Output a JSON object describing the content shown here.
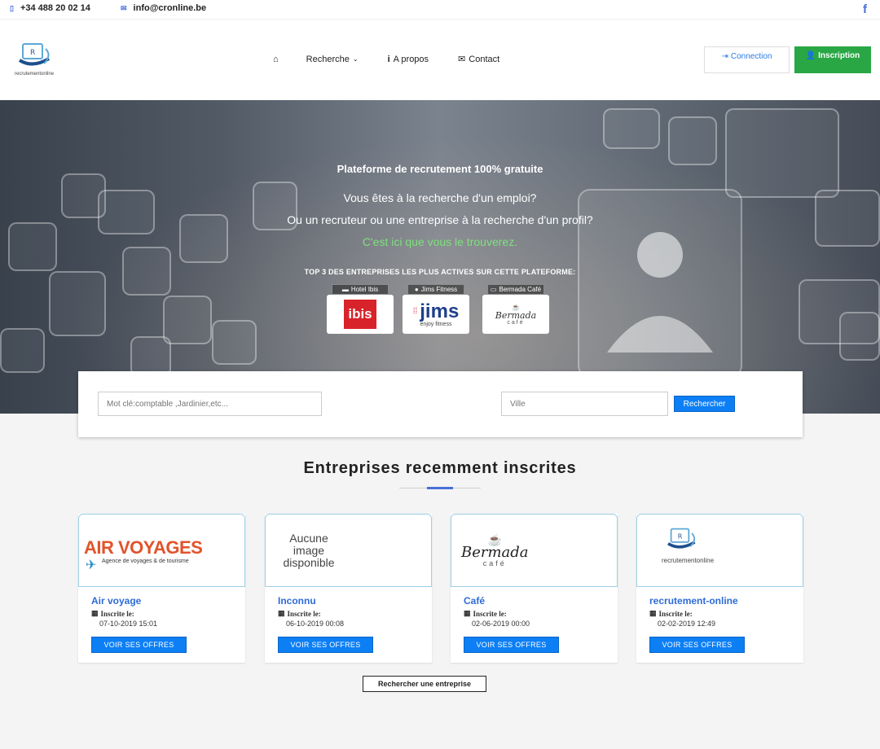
{
  "topbar": {
    "phone": "+34 488 20 02 14",
    "email": "info@cronline.be",
    "facebook_label": "f"
  },
  "header": {
    "logo_text": "recrutementonline",
    "nav": {
      "home_icon": "home-icon",
      "search_label": "Recherche",
      "about_label": "A propos",
      "contact_label": "Contact"
    },
    "connect_label": "Connection",
    "register_label": "Inscription"
  },
  "hero": {
    "title": "Plateforme de recrutement 100% gratuite",
    "line1": "Vous êtes à la recherche d'un emploi?",
    "line2": "Ou un recruteur ou une entreprise à la recherche d'un profil?",
    "line3": "C'est ici que vous le trouverez.",
    "top3_heading": "TOP 3 DES ENTREPRISES LES PLUS ACTIVES SUR CETTE PLATEFORME:",
    "top3": [
      {
        "tag": "Hotel Ibis",
        "logo_text": "ibis"
      },
      {
        "tag": "Jims Fitness",
        "logo_text": "jims",
        "logo_sub": "enjoy fitness"
      },
      {
        "tag": "Bermada Café",
        "logo_text": "Bermada",
        "logo_sub": "café"
      }
    ]
  },
  "search": {
    "keyword_placeholder": "Mot clé:comptable ,Jardinier,etc...",
    "city_placeholder": "Ville",
    "button_label": "Rechercher"
  },
  "recent": {
    "title": "Entreprises recemment inscrites",
    "since_label": "Inscrite le:",
    "offers_label": "VOIR SES OFFRES",
    "companies": [
      {
        "name": "Air voyage",
        "date": "07-10-2019 15:01",
        "logo_text": "AIR VOYAGES",
        "logo_sub": "Agence de voyages & de tourisme"
      },
      {
        "name": "Inconnu",
        "date": "06-10-2019 00:08",
        "no_image_text": "Aucune image disponible"
      },
      {
        "name": "Café",
        "date": "02-06-2019 00:00",
        "logo_text": "Bermada",
        "logo_sub": "café"
      },
      {
        "name": "recrutement-online",
        "date": "02-02-2019 12:49",
        "logo_text": "recrutementonline"
      }
    ],
    "find_company_label": "Rechercher une entreprise"
  },
  "colors": {
    "accent": "#4a6fd8",
    "primary_button": "#0d7ff5",
    "success": "#29a745",
    "green_text": "#7ee07e"
  }
}
